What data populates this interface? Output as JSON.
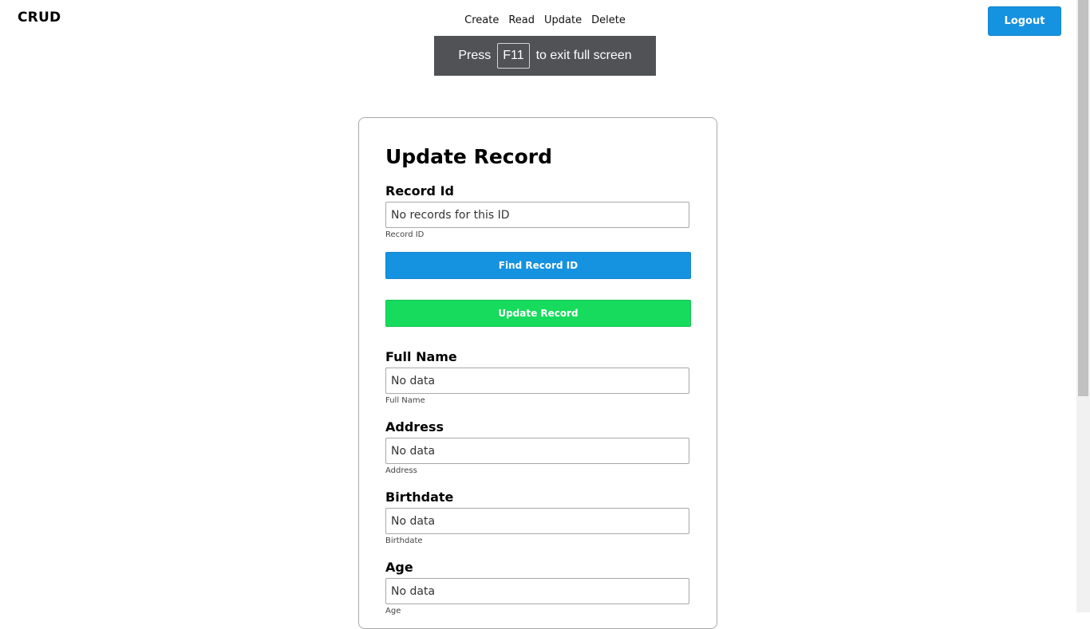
{
  "header": {
    "brand": "CRUD",
    "nav": [
      "Create",
      "Read",
      "Update",
      "Delete"
    ],
    "logout_label": "Logout"
  },
  "fullscreen_notice": {
    "press": "Press",
    "key": "F11",
    "rest": "to exit full screen"
  },
  "form": {
    "title": "Update Record",
    "record_id": {
      "label": "Record Id",
      "value": "No records for this ID",
      "hint": "Record ID"
    },
    "find_button": "Find Record ID",
    "update_button": "Update Record",
    "full_name": {
      "label": "Full Name",
      "value": "No data",
      "hint": "Full Name"
    },
    "address": {
      "label": "Address",
      "value": "No data",
      "hint": "Address"
    },
    "birthdate": {
      "label": "Birthdate",
      "value": "No data",
      "hint": "Birthdate"
    },
    "age": {
      "label": "Age",
      "value": "No data",
      "hint": "Age"
    }
  },
  "colors": {
    "primary": "#1592e0",
    "success": "#17db5c",
    "banner": "#505256"
  }
}
